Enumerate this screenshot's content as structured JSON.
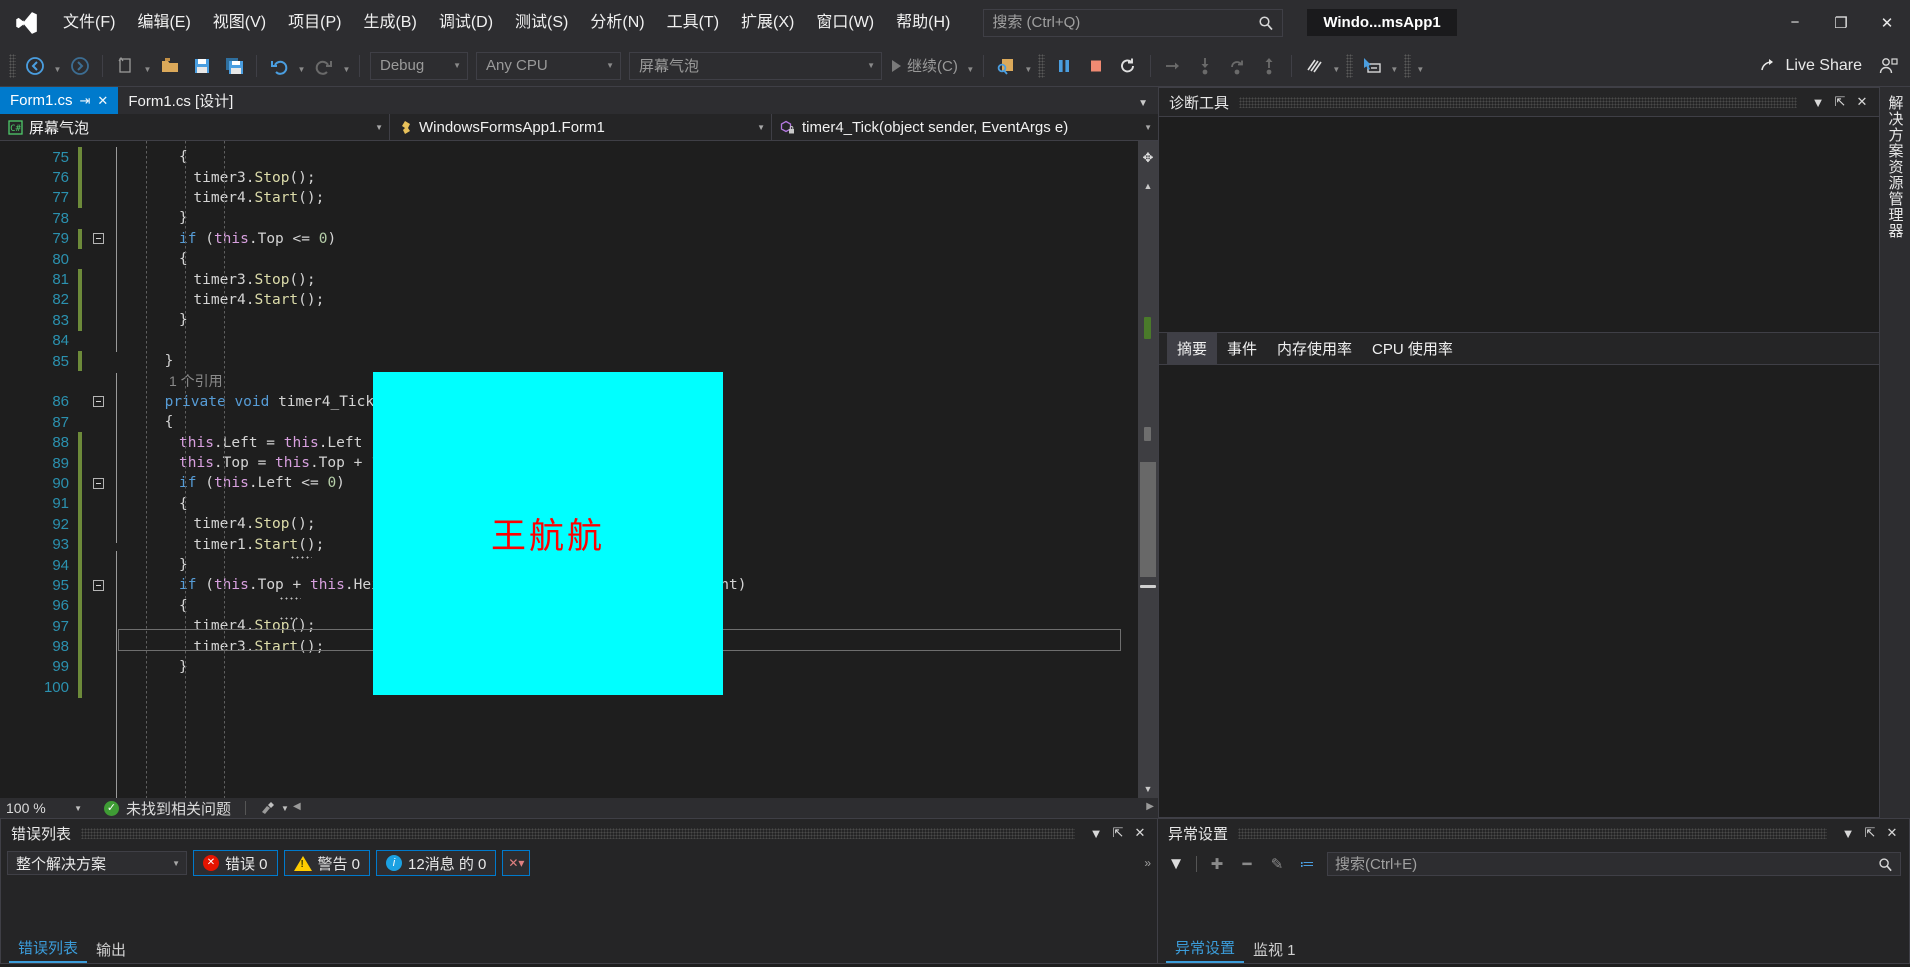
{
  "titlebar": {
    "logo_icon": "visual-studio-logo",
    "menus": [
      "文件(F)",
      "编辑(E)",
      "视图(V)",
      "项目(P)",
      "生成(B)",
      "调试(D)",
      "测试(S)",
      "分析(N)",
      "工具(T)",
      "扩展(X)",
      "窗口(W)",
      "帮助(H)"
    ],
    "search_placeholder": "搜索 (Ctrl+Q)",
    "search_value": "",
    "search_icon": "search-icon",
    "app_title": "Windo...msApp1",
    "minimize": "−",
    "restore": "❐",
    "close": "✕"
  },
  "toolbar": {
    "nav_back_icon": "arrow-back-icon",
    "nav_fwd_icon": "arrow-forward-icon",
    "new_item_icon": "new-item-icon",
    "open_icon": "open-folder-icon",
    "save_icon": "save-icon",
    "save_all_icon": "save-all-icon",
    "undo_icon": "undo-icon",
    "redo_icon": "redo-icon",
    "config_value": "Debug",
    "platform_value": "Any CPU",
    "startup_value": "屏幕气泡",
    "continue_label": "继续(C)",
    "attach_icon": "attach-process-icon",
    "pause_icon": "pause-icon",
    "stop_icon": "stop-icon",
    "restart_icon": "restart-icon",
    "step_over_icon": "step-over-icon",
    "step_into_icon": "step-into-icon",
    "step_return_icon": "step-out-icon",
    "step_up_icon": "step-up-icon",
    "hot_reload_icon": "hot-reload-icon",
    "select_element_icon": "select-element-icon",
    "live_share_label": "Live Share",
    "live_share_icon": "live-share-icon",
    "live_share_user_icon": "live-share-user-icon"
  },
  "tabs": {
    "active": {
      "label": "Form1.cs",
      "pin_icon": "pin-icon",
      "close_icon": "close-icon"
    },
    "inactive": {
      "label": "Form1.cs [设计]"
    },
    "overflow_icon": "chevron-down-icon"
  },
  "navbar": {
    "project": {
      "icon": "csharp-project-icon",
      "label": "屏幕气泡"
    },
    "type": {
      "icon": "class-icon",
      "label": "WindowsFormsApp1.Form1"
    },
    "member": {
      "icon": "method-private-icon",
      "label": "timer4_Tick(object sender, EventArgs e)"
    }
  },
  "editor": {
    "first_line": 75,
    "codelens_label": "1 个引用",
    "current_line": 98,
    "lines": [
      {
        "n": 75,
        "indent": 5,
        "changed": true,
        "fold": "none",
        "text": "{"
      },
      {
        "n": 76,
        "indent": 6,
        "changed": true,
        "fold": "none",
        "text": "timer3.Stop();"
      },
      {
        "n": 77,
        "indent": 6,
        "changed": true,
        "fold": "none",
        "text": "timer4.Start();"
      },
      {
        "n": 78,
        "indent": 5,
        "changed": false,
        "fold": "none",
        "text": "}"
      },
      {
        "n": 79,
        "indent": 5,
        "changed": true,
        "fold": "open",
        "text": "if (this.Top <= 0)"
      },
      {
        "n": 80,
        "indent": 5,
        "changed": false,
        "fold": "none",
        "text": "{"
      },
      {
        "n": 81,
        "indent": 6,
        "changed": true,
        "fold": "none",
        "text": "timer3.Stop();"
      },
      {
        "n": 82,
        "indent": 6,
        "changed": true,
        "fold": "none",
        "text": "timer4.Start();"
      },
      {
        "n": 83,
        "indent": 5,
        "changed": true,
        "fold": "none",
        "text": "}"
      },
      {
        "n": 84,
        "indent": 0,
        "changed": false,
        "fold": "none",
        "text": ""
      },
      {
        "n": 85,
        "indent": 4,
        "changed": true,
        "fold": "none",
        "text": "}"
      },
      {
        "n": 86,
        "indent": 4,
        "changed": false,
        "fold": "open",
        "text": "private void timer4_Tick(object sender, EventArgs e)"
      },
      {
        "n": 87,
        "indent": 4,
        "changed": false,
        "fold": "none",
        "text": "{"
      },
      {
        "n": 88,
        "indent": 5,
        "changed": true,
        "fold": "none",
        "text": "this.Left = this.Left - 10;"
      },
      {
        "n": 89,
        "indent": 5,
        "changed": true,
        "fold": "none",
        "text": "this.Top = this.Top + 10;"
      },
      {
        "n": 90,
        "indent": 5,
        "changed": true,
        "fold": "open",
        "text": "if (this.Left <= 0)"
      },
      {
        "n": 91,
        "indent": 5,
        "changed": true,
        "fold": "none",
        "text": "{"
      },
      {
        "n": 92,
        "indent": 6,
        "changed": true,
        "fold": "none",
        "text": "timer4.Stop();"
      },
      {
        "n": 93,
        "indent": 6,
        "changed": true,
        "fold": "none",
        "text": "timer1.Start();"
      },
      {
        "n": 94,
        "indent": 5,
        "changed": true,
        "fold": "none",
        "text": "}"
      },
      {
        "n": 95,
        "indent": 5,
        "changed": true,
        "fold": "open",
        "text": "if (this.Top + this.Height >= Screen.PrimaryScreen.Bounds.Height)"
      },
      {
        "n": 96,
        "indent": 5,
        "changed": true,
        "fold": "none",
        "text": "{"
      },
      {
        "n": 97,
        "indent": 6,
        "changed": true,
        "fold": "none",
        "text": "timer4.Stop();"
      },
      {
        "n": 98,
        "indent": 6,
        "changed": true,
        "fold": "none",
        "text": "timer3.Start();"
      },
      {
        "n": 99,
        "indent": 5,
        "changed": true,
        "fold": "none",
        "text": "}"
      },
      {
        "n": 100,
        "indent": 4,
        "changed": true,
        "fold": "none",
        "text": ""
      }
    ]
  },
  "floating_form": {
    "text": "王航航",
    "bg_color": "#00ffff",
    "text_color": "#ff0000"
  },
  "status_bar": {
    "zoom": "100 %",
    "zoom_caret_icon": "chevron-down-icon",
    "issues_label": "未找到相关问题",
    "issues_icon": "check-circle-icon",
    "brush_icon": "brush-icon"
  },
  "diagnostics": {
    "title": "诊断工具",
    "menu_icon": "chevron-down-icon",
    "pin_icon": "pin-icon",
    "close_icon": "close-icon",
    "tabs": [
      "摘要",
      "事件",
      "内存使用率",
      "CPU 使用率"
    ],
    "selected_tab": "摘要"
  },
  "solution_explorer_tab": {
    "label": "解决方案资源管理器"
  },
  "error_list": {
    "title": "错误列表",
    "menu_icon": "chevron-down-icon",
    "pin_icon": "pin-icon",
    "close_icon": "close-icon",
    "scope_value": "整个解决方案",
    "scope_caret_icon": "chevron-down-icon",
    "errors_label": "错误 0",
    "warnings_label": "警告 0",
    "messages_label": "12消息 的 0",
    "filter_icon": "filter-clear-icon",
    "tabs": [
      "错误列表",
      "输出"
    ],
    "selected_tab": "错误列表",
    "overflow_icon": "chevrons-right-icon"
  },
  "exception_settings": {
    "title": "异常设置",
    "menu_icon": "chevron-down-icon",
    "pin_icon": "pin-icon",
    "close_icon": "close-icon",
    "filter_icon": "filter-icon",
    "add_icon": "plus-icon",
    "remove_icon": "minus-icon",
    "edit_icon": "pencil-icon",
    "columns_icon": "columns-icon",
    "search_placeholder": "搜索(Ctrl+E)",
    "search_value": "",
    "search_icon": "search-icon",
    "tabs": [
      "异常设置",
      "监视 1"
    ],
    "selected_tab": "异常设置"
  }
}
